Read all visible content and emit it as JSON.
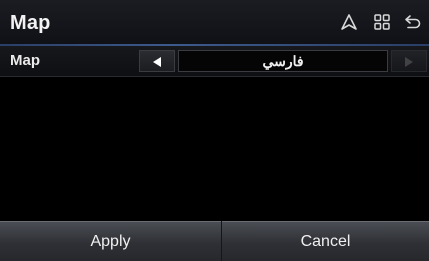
{
  "header": {
    "title": "Map",
    "icons": [
      "navigation-icon",
      "grid-menu-icon",
      "back-icon"
    ]
  },
  "setting": {
    "label": "Map",
    "value": "فارسي",
    "prev_icon": "left-arrow-icon",
    "next_icon": "right-arrow-icon"
  },
  "footer": {
    "apply_label": "Apply",
    "cancel_label": "Cancel"
  },
  "colors": {
    "background": "#000000",
    "header_separator": "#3d5a8c",
    "button": "#3a3c41"
  }
}
